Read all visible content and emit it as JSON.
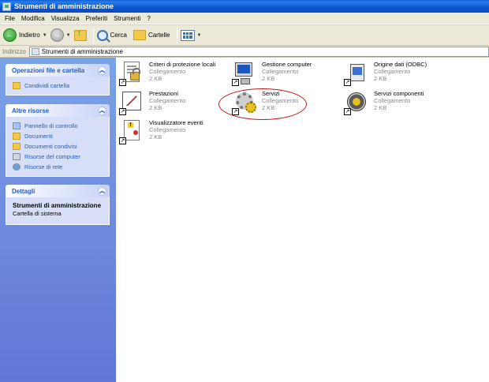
{
  "window": {
    "title": "Strumenti di amministrazione"
  },
  "menu": [
    "File",
    "Modifica",
    "Visualizza",
    "Preferiti",
    "Strumenti",
    "?"
  ],
  "toolbar": {
    "back_label": "Indietro",
    "search_label": "Cerca",
    "folders_label": "Cartelle"
  },
  "address": {
    "label": "Indirizzo",
    "value": "Strumenti di amministrazione"
  },
  "left": {
    "file_tasks": {
      "title": "Operazioni file e cartella",
      "items": [
        "Condividi cartella"
      ]
    },
    "other_places": {
      "title": "Altre risorse",
      "items": [
        "Pannello di controllo",
        "Documenti",
        "Documenti condivisi",
        "Risorse del computer",
        "Risorse di rete"
      ]
    },
    "details": {
      "title": "Dettagli",
      "name": "Strumenti di amministrazione",
      "desc": "Cartella di sistema"
    }
  },
  "files": [
    {
      "name": "Criteri di protezione locali",
      "type": "Collegamento",
      "size": "2 KB",
      "icon": "security-policy-icon"
    },
    {
      "name": "Gestione computer",
      "type": "Collegamento",
      "size": "2 KB",
      "icon": "computer-management-icon"
    },
    {
      "name": "Origine dati (ODBC)",
      "type": "Collegamento",
      "size": "2 KB",
      "icon": "odbc-icon"
    },
    {
      "name": "Prestazioni",
      "type": "Collegamento",
      "size": "2 KB",
      "icon": "performance-icon"
    },
    {
      "name": "Servizi",
      "type": "Collegamento",
      "size": "2 KB",
      "icon": "services-icon"
    },
    {
      "name": "Servizi componenti",
      "type": "Collegamento",
      "size": "2 KB",
      "icon": "component-services-icon"
    },
    {
      "name": "Visualizzatore eventi",
      "type": "Collegamento",
      "size": "2 KB",
      "icon": "event-viewer-icon"
    }
  ],
  "colors": {
    "titlebar": "#0a55d0",
    "taskpane": "#7ba2e7",
    "link": "#215dc6",
    "highlight": "#c01818"
  }
}
